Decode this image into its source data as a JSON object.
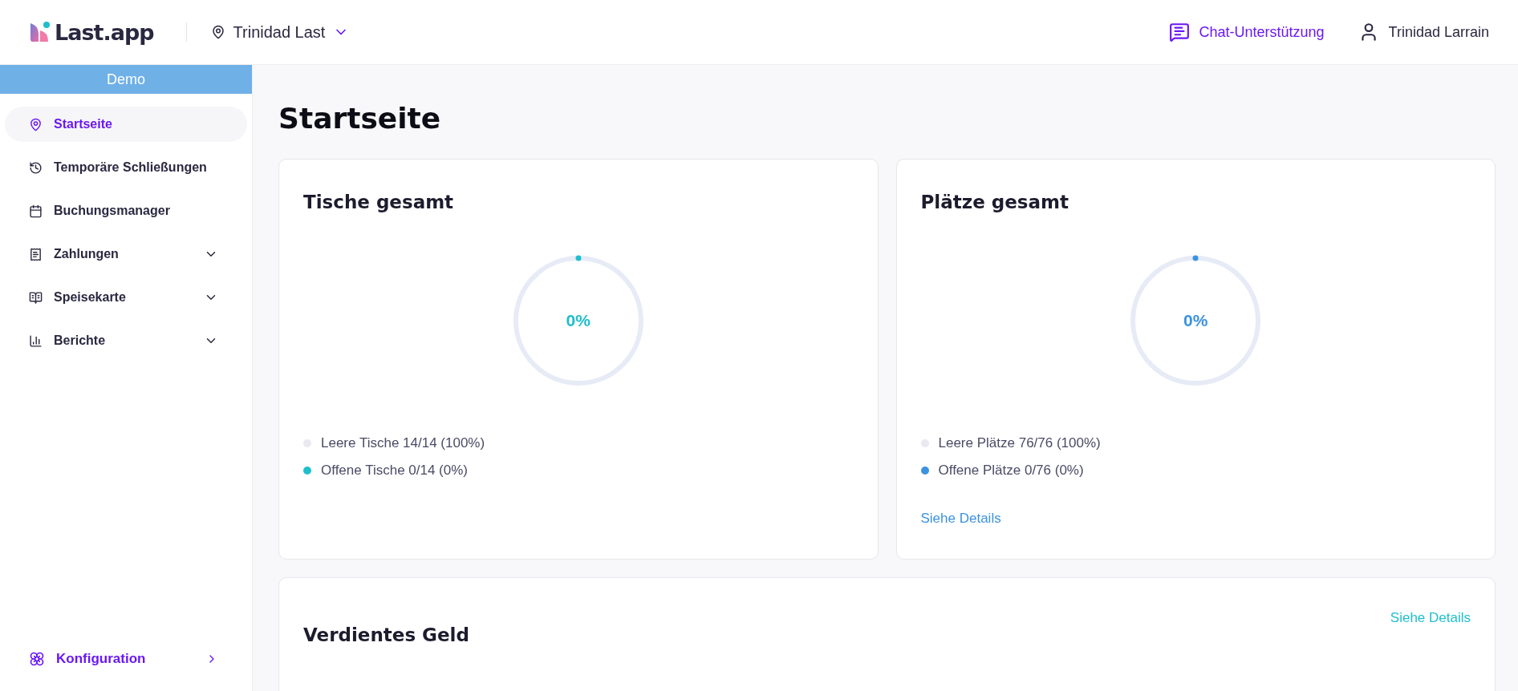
{
  "header": {
    "logo": "Last.app",
    "location": "Trinidad Last",
    "chat": "Chat-Unterstützung",
    "user": "Trinidad Larrain"
  },
  "sidebar": {
    "banner": "Demo",
    "items": [
      {
        "label": "Startseite",
        "selected": true,
        "has_submenu": false
      },
      {
        "label": "Temporäre Schließungen",
        "selected": false,
        "has_submenu": false
      },
      {
        "label": "Buchungsmanager",
        "selected": false,
        "has_submenu": false
      },
      {
        "label": "Zahlungen",
        "selected": false,
        "has_submenu": true
      },
      {
        "label": "Speisekarte",
        "selected": false,
        "has_submenu": true
      },
      {
        "label": "Berichte",
        "selected": false,
        "has_submenu": true
      }
    ],
    "footer": {
      "label": "Konfiguration"
    }
  },
  "page_title": "Startseite",
  "cards": [
    {
      "title": "Tische gesamt",
      "value": "0%",
      "level": 0,
      "color": "#1fbfcc",
      "legend": [
        {
          "label": "Leere Tische 14/14 (100%)",
          "color": "#e8e9f1"
        },
        {
          "label": "Offene Tische 0/14 (0%)",
          "color": "#1fbfcc"
        }
      ]
    },
    {
      "title": "Plätze gesamt",
      "value": "0%",
      "level": 0,
      "color": "#3b92e0",
      "legend": [
        {
          "label": "Leere Plätze 76/76 (100%)",
          "color": "#e8e9f1"
        },
        {
          "label": "Offene Plätze 0/76 (0%)",
          "color": "#3b92e0"
        }
      ],
      "link": "Siehe Details"
    }
  ],
  "earnings": {
    "title": "Verdientes Geld",
    "link": "Siehe Details"
  }
}
